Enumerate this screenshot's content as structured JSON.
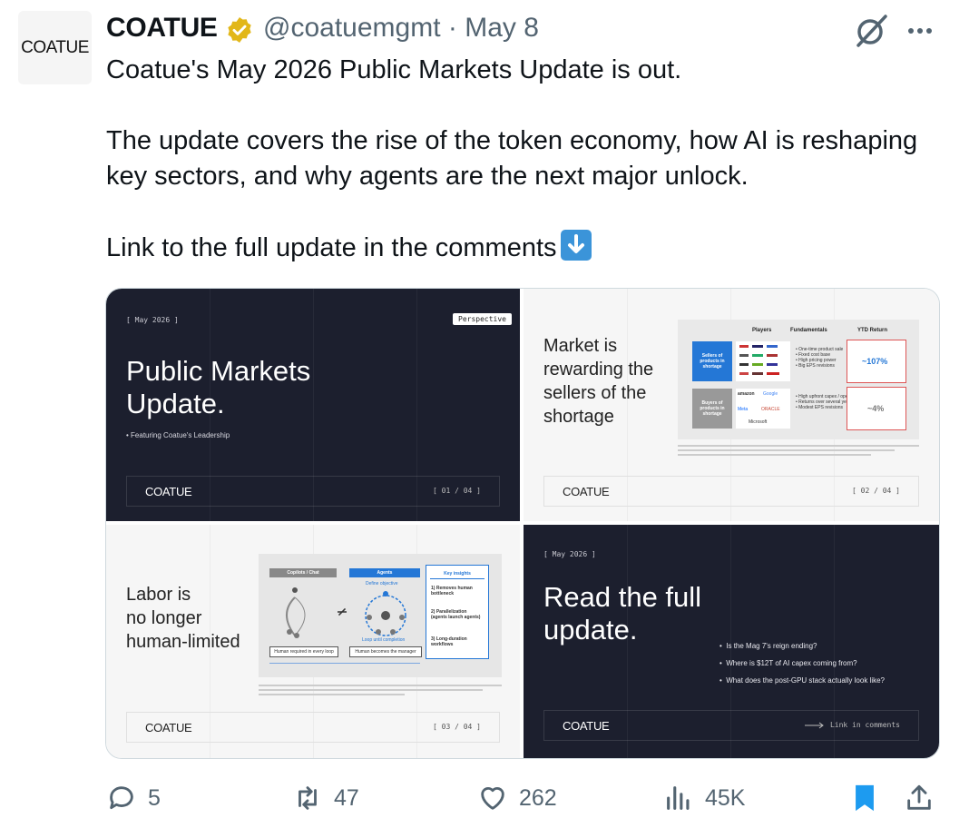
{
  "author": {
    "avatar_text": "COATUE",
    "name": "COATUE",
    "handle": "@coatuemgmt",
    "date": "May 8",
    "separator": "·"
  },
  "tweet": {
    "line1": "Coatue's May 2026 Public Markets Update is out.",
    "line2": "The update covers the rise of the token economy, how AI is reshaping key sectors, and why agents are the next major unlock.",
    "line3": "Link to the full update in the comments",
    "emoji": "down-arrow-emoji"
  },
  "slides": {
    "s1": {
      "date": "[ May 2026 ]",
      "tag": "Perspective",
      "title_l1": "Public Markets",
      "title_l2": "Update.",
      "bullet": "Featuring Coatue's Leadership",
      "logo": "COATUE",
      "page": "[ 01 / 04 ]"
    },
    "s2": {
      "title_l1": "Market is",
      "title_l2": "rewarding the",
      "title_l3": "sellers of the",
      "title_l4": "shortage",
      "col_players": "Players",
      "col_fundamentals": "Fundamentals",
      "col_ytd": "YTD Return",
      "row1_label": "Sellers of products in shortage",
      "row1_f1": "• One-time product sale",
      "row1_f2": "• Fixed cost base",
      "row1_f3": "• High pricing power",
      "row1_f4": "• Big EPS revisions",
      "row1_ytd": "~107%",
      "row2_label": "Buyers of products in shortage",
      "row2_f1": "• High upfront capex / opex",
      "row2_f2": "• Returns over several years",
      "row2_f3": "• Modest EPS revisions",
      "row2_ytd": "~4%",
      "row2_p1": "amazon",
      "row2_p2": "Google",
      "row2_p3": "Meta",
      "row2_p4": "ORACLE",
      "row2_p5": "Microsoft",
      "logo": "COATUE",
      "page": "[ 02 / 04 ]"
    },
    "s3": {
      "title_l1": "Labor is",
      "title_l2": "no longer",
      "title_l3": "human-limited",
      "pill_copilots": "Copilots / Chat",
      "pill_agents": "Agents",
      "pill_insights": "Key insights",
      "ins1": "1) Removes human bottleneck",
      "ins2": "2) Parallelization (agents launch agents)",
      "ins3": "3) Long-duration workflows",
      "foot1": "Human required in every loop",
      "foot2": "Human becomes the manager",
      "define": "Define objective",
      "loop": "Loop until completion",
      "logo": "COATUE",
      "page": "[ 03 / 04 ]"
    },
    "s4": {
      "date": "[ May 2026 ]",
      "title_l1": "Read the full",
      "title_l2": "update.",
      "q1": "Is the Mag 7's reign ending?",
      "q2": "Where is $12T of AI capex coming from?",
      "q3": "What does the post-GPU stack actually look like?",
      "logo": "COATUE",
      "link": "Link in comments"
    }
  },
  "actions": {
    "replies": "5",
    "reposts": "47",
    "likes": "262",
    "views": "45K"
  },
  "colors": {
    "accent": "#1d9bf0",
    "muted": "#536471",
    "slide_dark": "#1c1f2e",
    "badge": "#e2b719"
  }
}
